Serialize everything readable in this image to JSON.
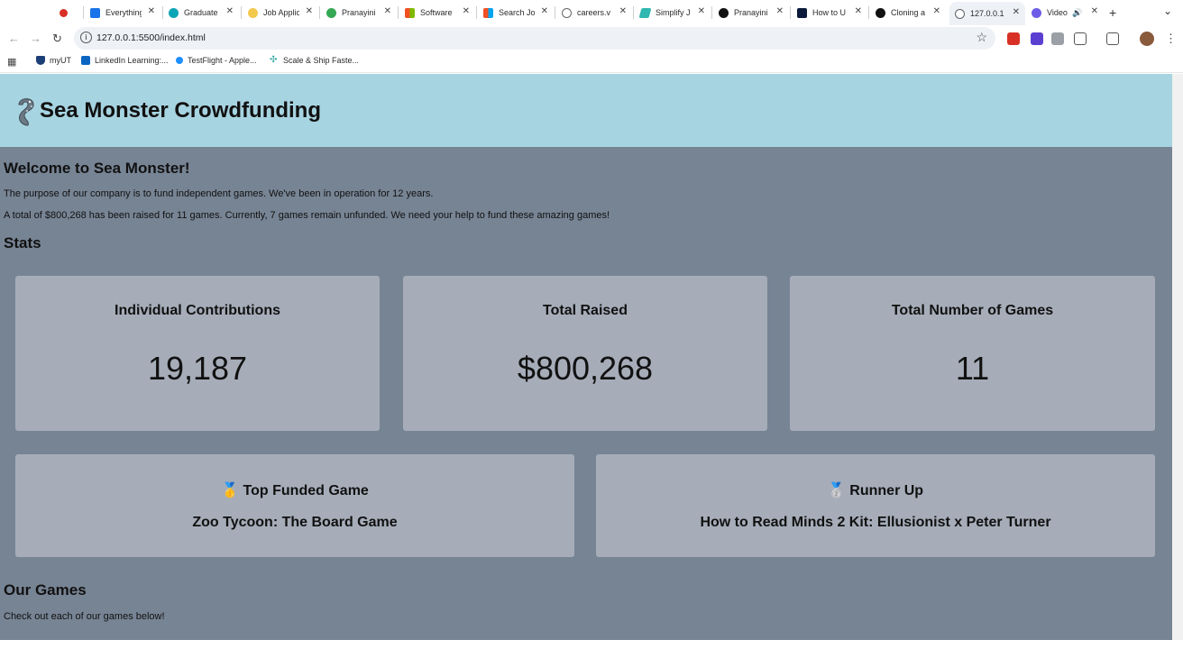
{
  "browser": {
    "tabs": [
      {
        "title": "",
        "fav_color": "#d93025"
      },
      {
        "title": "Everything",
        "fav_color": "#1a73e8"
      },
      {
        "title": "Graduate",
        "fav_color": "#0aa5b5"
      },
      {
        "title": "Job Applic",
        "fav_color": "#f2c94c"
      },
      {
        "title": "Pranayini",
        "fav_color": "#34a853"
      },
      {
        "title": "Software",
        "fav_color": "#f25022"
      },
      {
        "title": "Search Jo",
        "fav_color": "#f25022"
      },
      {
        "title": "careers.v",
        "fav_color": "#777777"
      },
      {
        "title": "Simplify J",
        "fav_color": "#2fb7b0"
      },
      {
        "title": "Pranayini",
        "fav_color": "#111111"
      },
      {
        "title": "How to U",
        "fav_color": "#0b1a3a"
      },
      {
        "title": "Cloning a",
        "fav_color": "#111111"
      },
      {
        "title": "127.0.0.1",
        "fav_color": "#5f6368"
      },
      {
        "title": "Video",
        "fav_color": "#6c5ce7"
      }
    ],
    "url": "127.0.0.1:5500/index.html",
    "bookmarks": [
      {
        "label": "myUT",
        "color": "#1c3f77"
      },
      {
        "label": "LinkedIn Learning:...",
        "color": "#0a66c2"
      },
      {
        "label": "TestFlight - Apple...",
        "color": "#1e90ff"
      },
      {
        "label": "Scale & Ship Faste...",
        "color": "#2aa7a0"
      }
    ]
  },
  "site": {
    "title": "Sea Monster Crowdfunding"
  },
  "welcome": {
    "heading": "Welcome to Sea Monster!",
    "paragraph1": "The purpose of our company is to fund independent games. We've been in operation for 12 years.",
    "paragraph2": "A total of $800,268 has been raised for 11 games. Currently, 7 games remain unfunded. We need your help to fund these amazing games!"
  },
  "stats": {
    "heading": "Stats",
    "contributions": {
      "label": "Individual Contributions",
      "value": "19,187"
    },
    "raised": {
      "label": "Total Raised",
      "value": "$800,268"
    },
    "games": {
      "label": "Total Number of Games",
      "value": "11"
    },
    "top": {
      "label": "🥇 Top Funded Game",
      "value": "Zoo Tycoon: The Board Game"
    },
    "runner": {
      "label": "🥈 Runner Up",
      "value": "How to Read Minds 2 Kit: Ellusionist x Peter Turner"
    }
  },
  "games": {
    "heading": "Our Games",
    "subtitle": "Check out each of our games below!"
  },
  "colors": {
    "header_bg": "#a7d4e1",
    "page_bg": "#778494",
    "card_bg": "#a6adb9"
  }
}
